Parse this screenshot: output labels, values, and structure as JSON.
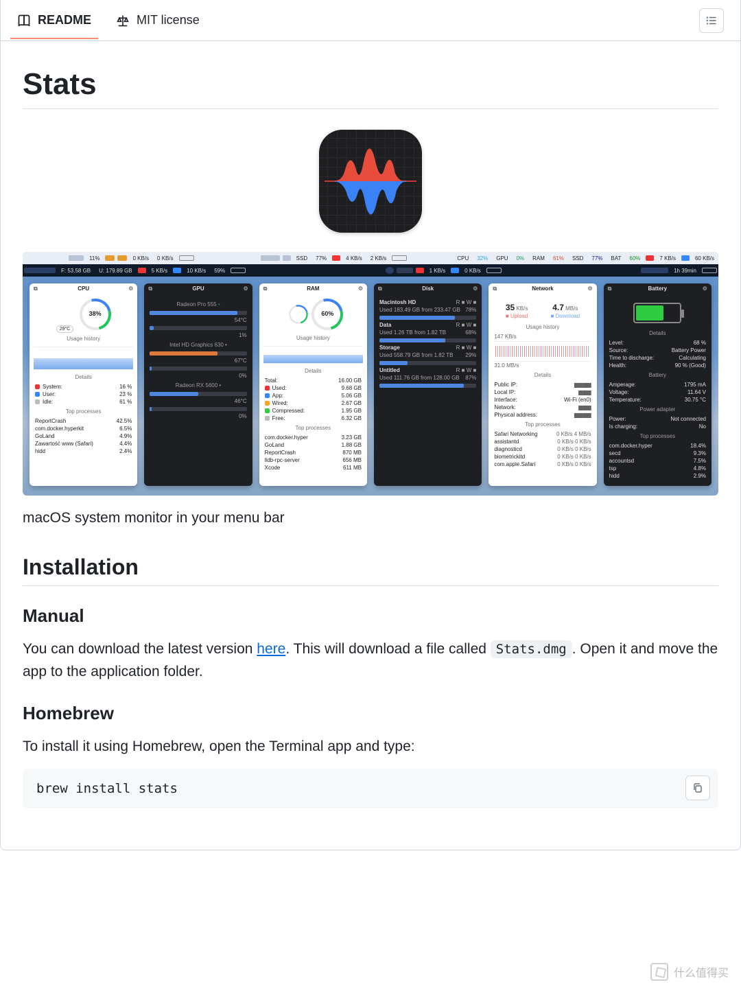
{
  "tabs": {
    "readme": "README",
    "license": "MIT license"
  },
  "title": "Stats",
  "tagline": "macOS system monitor in your menu bar",
  "sections": {
    "installation": "Installation",
    "manual": "Manual",
    "homebrew": "Homebrew"
  },
  "manual": {
    "part1": "You can download the latest version ",
    "link_text": "here",
    "part2": ". This will download a file called ",
    "filename": "Stats.dmg",
    "part3": ". Open it and move the app to the application folder."
  },
  "homebrew": {
    "intro": "To install it using Homebrew, open the Terminal app and type:",
    "command": "brew install stats"
  },
  "menubar_compact": {
    "cpu_label": "CPU",
    "cpu": "32%",
    "gpu_label": "GPU",
    "gpu": "0%",
    "ram_label": "RAM",
    "ram": "61%",
    "ssd_label": "SSD",
    "ssd": "77%",
    "bat_label": "BAT",
    "bat": "60%",
    "net_down": "7 KB/s",
    "net_up": "60 KB/s",
    "time": "1h 39min"
  },
  "menubar_light": {
    "pct1": "11%",
    "net": "0 KB/s",
    "net2": "0 KB/s"
  },
  "menubar_dark1": {
    "disk_f": "F: 53.58 GB",
    "disk_u": "U: 179.89 GB",
    "net_down": "5 KB/s",
    "net_up": "10 KB/s",
    "pct": "59%"
  },
  "menubar_dark2": {
    "ssd_label": "SSD",
    "ssd_pct": "77%",
    "net_down": "4 KB/s",
    "net_up": "2 KB/s"
  },
  "menubar_dark3": {
    "net_down": "1 KB/s",
    "net_up": "0 KB/s"
  },
  "panels": {
    "cpu": {
      "title": "CPU",
      "ring": "38%",
      "temp": "29°C",
      "usage_label": "Usage history",
      "details": "Details",
      "system_label": "System:",
      "system": "16 %",
      "user_label": "User:",
      "user": "23 %",
      "idle_label": "Idle:",
      "idle": "61 %",
      "top_label": "Top processes",
      "p1": "ReportCrash",
      "p1v": "42.5%",
      "p2": "com.docker.hyperkit",
      "p2v": "6.5%",
      "p3": "GoLand",
      "p3v": "4.9%",
      "p4": "Zawartość www (Safari)",
      "p4v": "4.4%",
      "p5": "hidd",
      "p5v": "2.4%"
    },
    "gpu": {
      "title": "GPU",
      "g1": "Radeon Pro 555",
      "g1t": "54°C",
      "g2": "Intel HD Graphics 630",
      "g2t": "67°C",
      "g3": "Radeon RX 5600",
      "g3t": "46°C",
      "pct1": "1%",
      "pct0": "0%"
    },
    "ram": {
      "title": "RAM",
      "ring": "60%",
      "usage_label": "Usage history",
      "details": "Details",
      "total_l": "Total:",
      "total": "16.00 GB",
      "used_l": "Used:",
      "used": "9.68 GB",
      "app_l": "App:",
      "app": "5.06 GB",
      "wired_l": "Wired:",
      "wired": "2.67 GB",
      "comp_l": "Compressed:",
      "comp": "1.95 GB",
      "free_l": "Free:",
      "free": "6.32 GB",
      "top_label": "Top processes",
      "p1": "com.docker.hyper",
      "p1v": "3.23 GB",
      "p2": "GoLand",
      "p2v": "1.88 GB",
      "p3": "ReportCrash",
      "p3v": "870 MB",
      "p4": "lldb-rpc-server",
      "p4v": "656 MB",
      "p5": "Xcode",
      "p5v": "611 MB"
    },
    "disk": {
      "title": "Disk",
      "d1": "Macintosh HD",
      "d1s": "Used 183.49 GB from 233.47 GB",
      "d1p": "78%",
      "d2": "Data",
      "d2s": "Used 1.26 TB from 1.82 TB",
      "d2p": "68%",
      "d3": "Storage",
      "d3s": "Used 558.79 GB from 1.82 TB",
      "d3p": "29%",
      "d4": "Untitled",
      "d4s": "Used 111.76 GB from 128.00 GB",
      "d4p": "87%",
      "rw": "R ■  W ■"
    },
    "net": {
      "title": "Network",
      "up": "35",
      "up_unit": "KB/s",
      "up_l": "Upload",
      "dn": "4.7",
      "dn_unit": "MB/s",
      "dn_l": "Download",
      "usage_label": "Usage history",
      "ymax": "147 KB/s",
      "ymin": "31.0 MB/s",
      "details": "Details",
      "pubip": "Public IP:",
      "locip": "Local IP:",
      "iface_l": "Interface:",
      "iface": "Wi-Fi (en0)",
      "net_l": "Network:",
      "phys": "Physical address:",
      "top_label": "Top processes",
      "p1": "Safari Networking",
      "p1v": "0 KB/s   4 MB/s",
      "p2": "assistantd",
      "p2v": "0 KB/s   0 KB/s",
      "p3": "diagnosticd",
      "p3v": "0 KB/s   0 KB/s",
      "p4": "biometrickitd",
      "p4v": "0 KB/s   0 KB/s",
      "p5": "com.apple.Safari",
      "p5v": "0 KB/s   0 KB/s"
    },
    "bat": {
      "title": "Battery",
      "details": "Details",
      "level_l": "Level:",
      "level": "68 %",
      "src_l": "Source:",
      "src": "Battery Power",
      "ttd_l": "Time to discharge:",
      "ttd": "Calculating",
      "health_l": "Health:",
      "health": "90 % (Good)",
      "section_bat": "Battery",
      "amp_l": "Amperage:",
      "amp": "1795 mA",
      "volt_l": "Voltage:",
      "volt": "11.64 V",
      "temp_l": "Temperature:",
      "temp": "30.75 °C",
      "section_pa": "Power adapter",
      "pw_l": "Power:",
      "pw": "Not connected",
      "chg_l": "Is charging:",
      "chg": "No",
      "top_label": "Top processes",
      "p1": "com.docker.hyper",
      "p1v": "18.4%",
      "p2": "secd",
      "p2v": "9.3%",
      "p3": "accountsd",
      "p3v": "7.5%",
      "p4": "tsp",
      "p4v": "4.8%",
      "p5": "hidd",
      "p5v": "2.9%"
    }
  },
  "watermark": "什么值得买"
}
